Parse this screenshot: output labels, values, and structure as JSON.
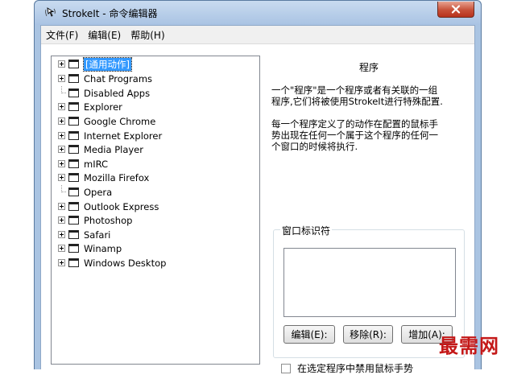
{
  "window": {
    "title": "StrokeIt - 命令编辑器"
  },
  "menu": [
    {
      "label": "文件(F)"
    },
    {
      "label": "编辑(E)"
    },
    {
      "label": "帮助(H)"
    }
  ],
  "tree": {
    "items": [
      {
        "label": "[通用动作]",
        "expandable": true,
        "selected": true
      },
      {
        "label": "Chat Programs",
        "expandable": true
      },
      {
        "label": "Disabled Apps",
        "expandable": false
      },
      {
        "label": "Explorer",
        "expandable": true
      },
      {
        "label": "Google Chrome",
        "expandable": true
      },
      {
        "label": "Internet Explorer",
        "expandable": true
      },
      {
        "label": "Media Player",
        "expandable": true
      },
      {
        "label": "mIRC",
        "expandable": true
      },
      {
        "label": "Mozilla Firefox",
        "expandable": true
      },
      {
        "label": "Opera",
        "expandable": false
      },
      {
        "label": "Outlook Express",
        "expandable": true
      },
      {
        "label": "Photoshop",
        "expandable": true
      },
      {
        "label": "Safari",
        "expandable": true
      },
      {
        "label": "Winamp",
        "expandable": true
      },
      {
        "label": "Windows Desktop",
        "expandable": true
      }
    ]
  },
  "panel": {
    "title": "程序",
    "description1": "一个\"程序\"是一个程序或者有关联的一组\n程序,它们将被使用StrokeIt进行特殊配置.",
    "description2": "每一个程序定义了的动作在配置的鼠标手\n势出现在任何一个属于这个程序的任何一\n个窗口的时候将执行."
  },
  "window_identifier": {
    "label": "窗口标识符",
    "edit_button": "编辑(E):",
    "remove_button": "移除(R):",
    "add_button": "增加(A):"
  },
  "disable_gestures_checkbox": {
    "label": "在选定程序中禁用鼠标手势",
    "checked": false
  },
  "watermark": "最需网"
}
